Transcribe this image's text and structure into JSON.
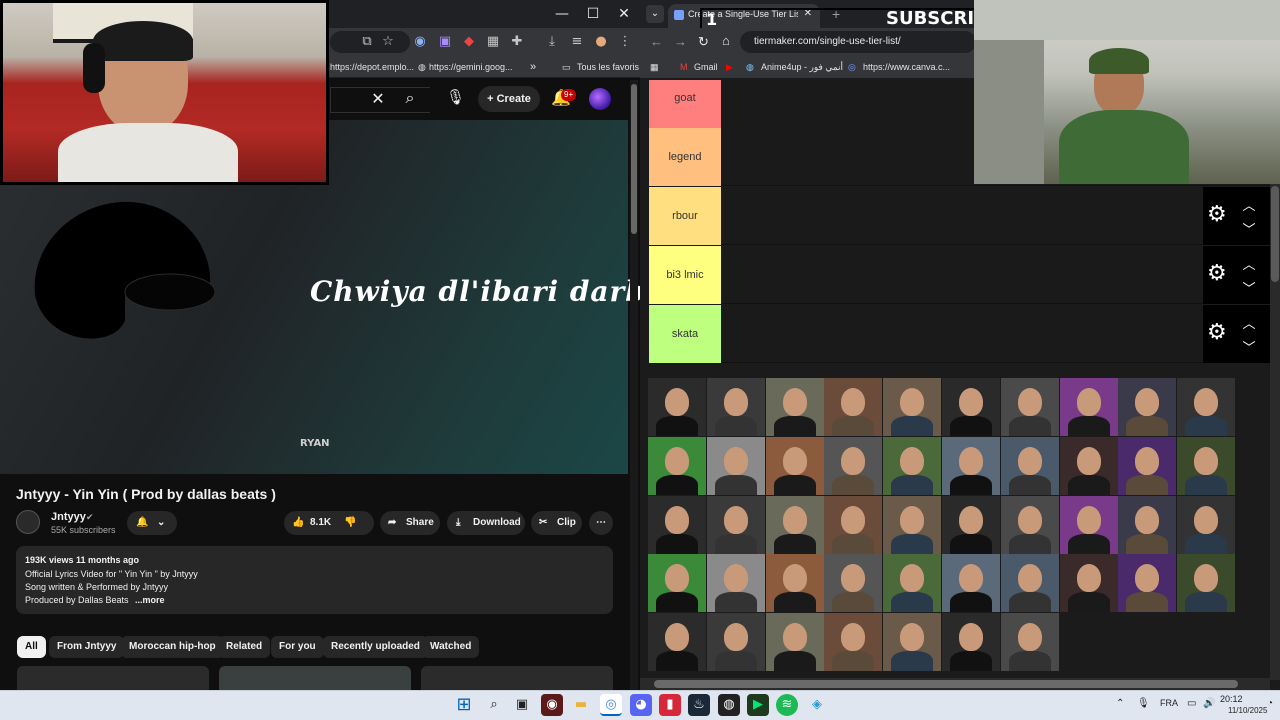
{
  "left_window": {
    "bookmarks": [
      "https://depot.emplo...",
      "https://gemini.goog...",
      "»",
      "Tous les favoris"
    ],
    "yt_header": {
      "create_label": "Create",
      "notif_count": "9+"
    },
    "video": {
      "lyric_text": "Chwiya dl'ibari darb",
      "watermark": "RYAN",
      "title": "Jntyyy - Yin Yin ( Prod by dallas beats )",
      "channel_name": "Jntyyy",
      "channel_verified": "✔",
      "subscribers": "55K subscribers",
      "likes": "8.1K",
      "share_label": "Share",
      "download_label": "Download",
      "clip_label": "Clip"
    },
    "description": {
      "meta": "193K views  11 months ago",
      "line1": "Official Lyrics Video for \" Yin Yin \" by Jntyyy",
      "line2": "Song written & Performed by Jntyyy",
      "line3": "Produced by Dallas Beats",
      "more": "...more"
    },
    "chips": [
      "All",
      "From Jntyyy",
      "Moroccan hip-hop",
      "Related",
      "For you",
      "Recently uploaded",
      "Watched"
    ]
  },
  "right_window": {
    "tab_title": "Create a Single-Use Tier List (P...",
    "tab_number": "1",
    "subscribe_banner": "SUBSCRI",
    "url": "tiermaker.com/single-use-tier-list/",
    "bookmarks": [
      "Gmail",
      "Anime4up - أنمي فور",
      "https://www.canva.c..."
    ],
    "tiers": [
      {
        "label": "goat",
        "color": "#ff7f7f"
      },
      {
        "label": "legend",
        "color": "#ffbf7f"
      },
      {
        "label": "rbour",
        "color": "#ffdf7f"
      },
      {
        "label": "bi3 lmic",
        "color": "#ffff7f"
      },
      {
        "label": "skata",
        "color": "#bfff7f"
      }
    ],
    "grid_rows": 5,
    "grid_cols": 10,
    "grid_count": 47
  },
  "taskbar": {
    "language": "FRA",
    "time": "20:12",
    "date": "11/10/2025"
  }
}
